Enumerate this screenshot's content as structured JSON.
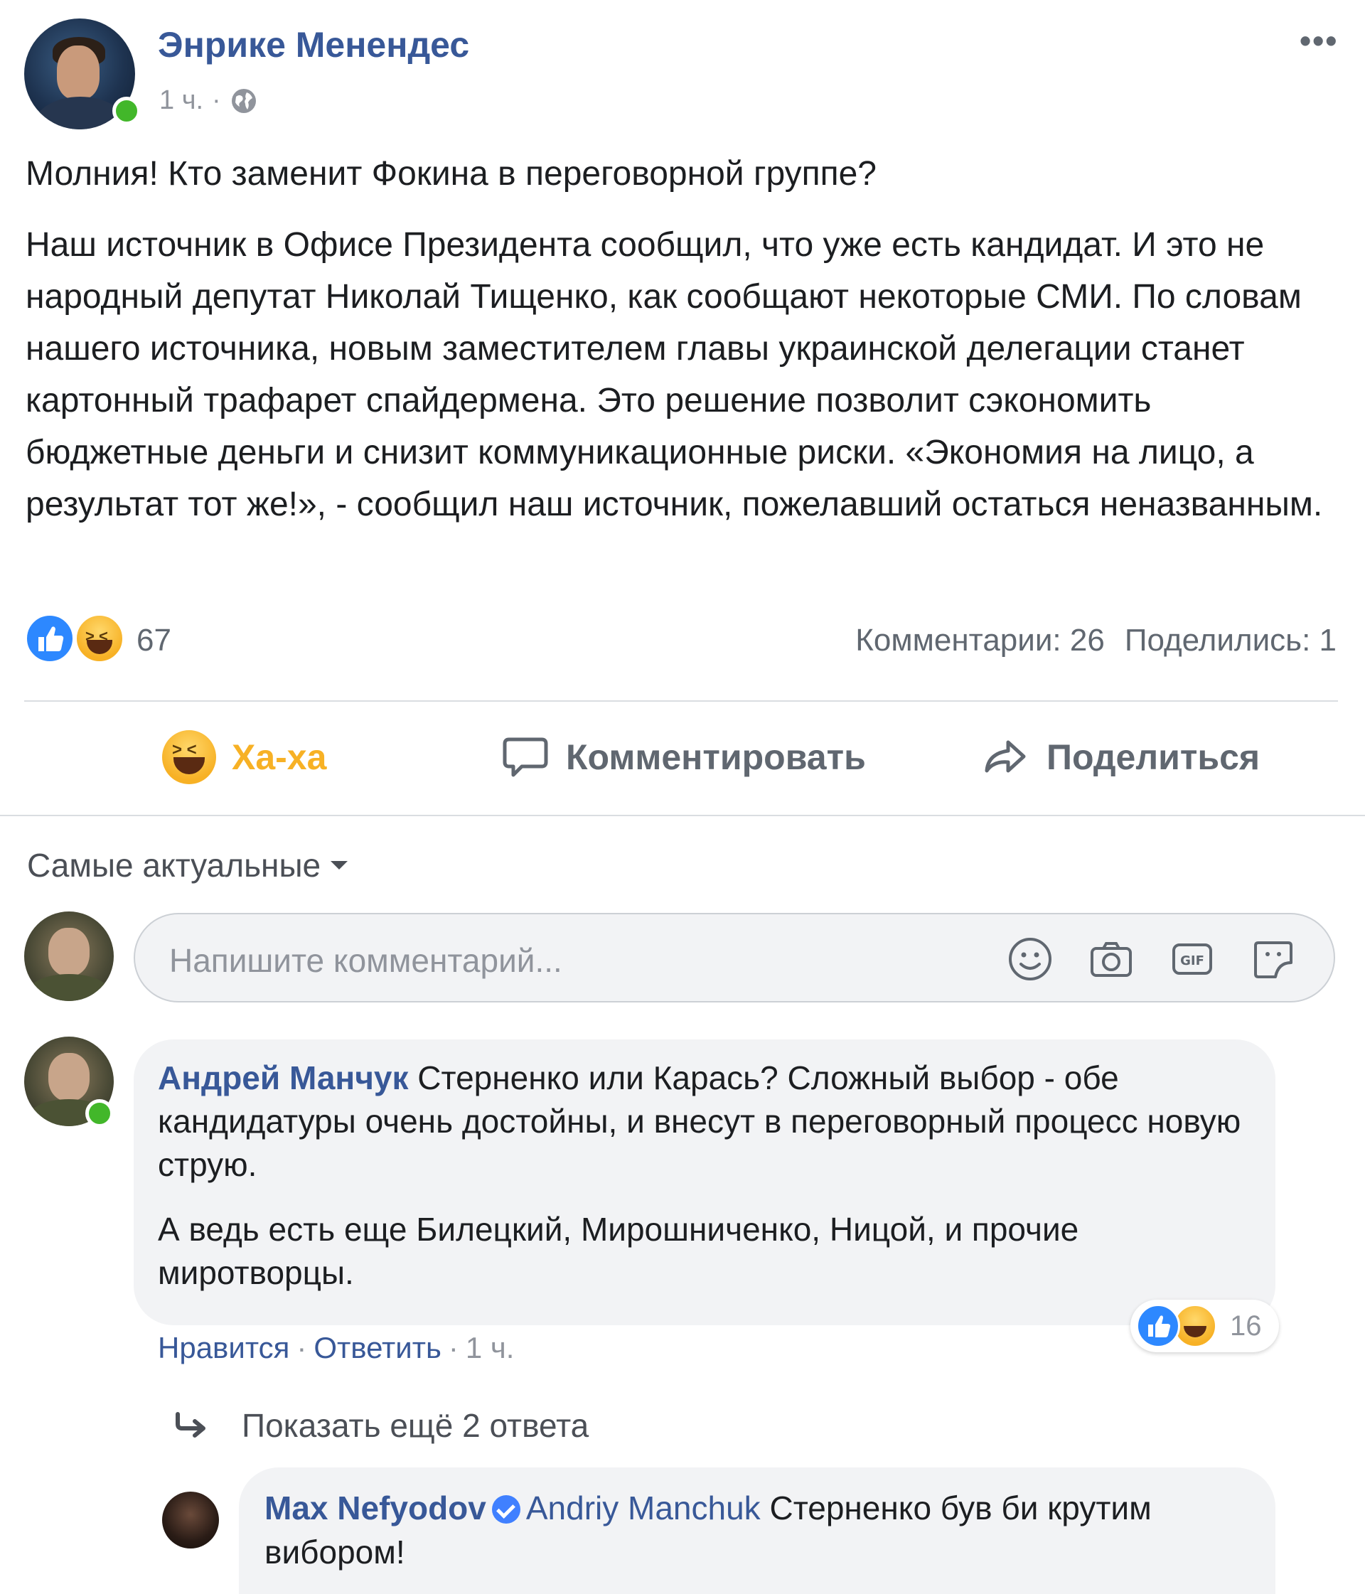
{
  "post": {
    "author": "Энрике Менендес",
    "time": "1 ч.",
    "separator": "·",
    "privacy_icon": "globe-icon",
    "more_icon": "more-dots-icon",
    "more_label": "•••",
    "headline": "Молния! Кто заменит Фокина в переговорной группе?",
    "body": "Наш источник в Офисе Президента сообщил, что уже есть кандидат. И это не народный депутат Николай Тищенко, как сообщают некоторые СМИ. По словам нашего источника, новым заместителем главы украинской делегации станет картонный трафарет спайдермена. Это решение позволит сэкономить бюджетные деньги и снизит коммуникационные риски. «Экономия на лицо, а результат тот же!», - сообщил наш источник, пожелавший остаться неназванным."
  },
  "reactions": {
    "icons": [
      "like-icon",
      "haha-icon"
    ],
    "count": "67",
    "comments": "Комментарии: 26",
    "shares": "Поделились: 1"
  },
  "actions": {
    "haha_label": "Ха-ха",
    "comment_label": "Комментировать",
    "share_label": "Поделиться"
  },
  "comments_section": {
    "sort_label": "Самые актуальные",
    "input_placeholder": "Напишите комментарий...",
    "input_icons": [
      "emoji-icon",
      "camera-icon",
      "gif-icon",
      "sticker-icon"
    ],
    "gif_text": "GIF"
  },
  "comment": {
    "author": "Андрей Манчук",
    "text_part1": "Стерненко или Карась? Сложный выбор - обе кандидатуры очень достойны, и внесут в переговорный процесс новую струю.",
    "text_part2": "А ведь есть еще Билецкий, Мирошниченко, Ницой, и прочие миротворцы.",
    "like_label": "Нравится",
    "reply_label": "Ответить",
    "time": "1 ч.",
    "dot": "·",
    "reaction_count": "16"
  },
  "replies": {
    "show_more": "Показать ещё 2 ответа"
  },
  "reply": {
    "author": "Max Nefyodov",
    "mention": "Andriy Manchuk",
    "text": "Стерненко був би крутим вибором!"
  },
  "colors": {
    "link_blue": "#385898",
    "haha_yellow": "#f7b125",
    "like_blue": "#2d88ff",
    "online_green": "#42b72a",
    "bubble_gray": "#f2f3f5"
  }
}
